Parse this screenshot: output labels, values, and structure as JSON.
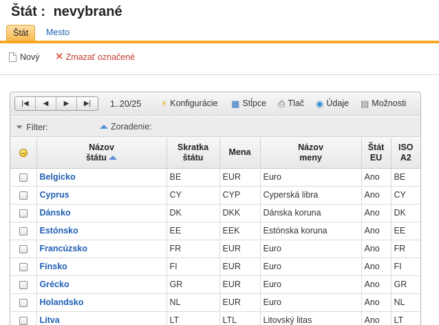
{
  "page": {
    "title_label": "Štát :",
    "title_value": "nevybrané"
  },
  "tabs": [
    {
      "label": "Štát",
      "active": true
    },
    {
      "label": "Mesto",
      "active": false
    }
  ],
  "actions": {
    "new_label": "Nový",
    "delete_label": "Zmazať označené"
  },
  "grid": {
    "pager": {
      "first": "|◀",
      "prev": "◀",
      "next": "▶",
      "last": "▶|",
      "range": "1..20/25"
    },
    "tools": {
      "config": "Konfigurácie",
      "columns": "Stĺpce",
      "print": "Tlač",
      "data": "Údaje",
      "options": "Možnosti"
    },
    "filter_label": "Filter:",
    "sort_label": "Zoradenie:",
    "headers": {
      "name_line1": "Názov",
      "name_line2": "štátu",
      "abbr_line1": "Skratka",
      "abbr_line2": "štátu",
      "currency": "Mena",
      "currency_name_line1": "Názov",
      "currency_name_line2": "meny",
      "eu_line1": "Štát",
      "eu_line2": "EU",
      "iso_line1": "ISO",
      "iso_line2": "A2"
    },
    "rows": [
      {
        "name": "Belgicko",
        "abbr": "BE",
        "currency": "EUR",
        "currency_name": "Euro",
        "eu": "Ano",
        "iso": "BE"
      },
      {
        "name": "Cyprus",
        "abbr": "CY",
        "currency": "CYP",
        "currency_name": "Cyperská libra",
        "eu": "Ano",
        "iso": "CY"
      },
      {
        "name": "Dánsko",
        "abbr": "DK",
        "currency": "DKK",
        "currency_name": "Dánska koruna",
        "eu": "Ano",
        "iso": "DK"
      },
      {
        "name": "Estónsko",
        "abbr": "EE",
        "currency": "EEK",
        "currency_name": "Estónska koruna",
        "eu": "Ano",
        "iso": "EE"
      },
      {
        "name": "Francúzsko",
        "abbr": "FR",
        "currency": "EUR",
        "currency_name": "Euro",
        "eu": "Ano",
        "iso": "FR"
      },
      {
        "name": "Fínsko",
        "abbr": "FI",
        "currency": "EUR",
        "currency_name": "Euro",
        "eu": "Ano",
        "iso": "FI"
      },
      {
        "name": "Grécko",
        "abbr": "GR",
        "currency": "EUR",
        "currency_name": "Euro",
        "eu": "Ano",
        "iso": "GR"
      },
      {
        "name": "Holandsko",
        "abbr": "NL",
        "currency": "EUR",
        "currency_name": "Euro",
        "eu": "Ano",
        "iso": "NL"
      },
      {
        "name": "Litva",
        "abbr": "LT",
        "currency": "LTL",
        "currency_name": "Litovský litas",
        "eu": "Ano",
        "iso": "LT"
      }
    ]
  }
}
